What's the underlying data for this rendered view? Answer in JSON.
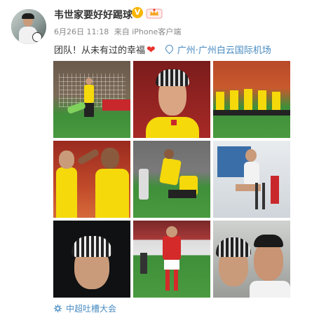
{
  "post": {
    "username": "韦世家要好好踢球",
    "verified_badge": "V",
    "date": "6月26日 11:18",
    "source": "来自 iPhone客户端",
    "text": "团队！从未有过的幸福",
    "emoji": "❤",
    "location": "广州·广州白云国际机场",
    "topic": "中超吐槽大会"
  },
  "photos": [
    {
      "label": "goal-scene"
    },
    {
      "label": "player-portrait"
    },
    {
      "label": "team-lineup"
    },
    {
      "label": "high-five"
    },
    {
      "label": "celebration-tackle"
    },
    {
      "label": "seated-player"
    },
    {
      "label": "selfie-close"
    },
    {
      "label": "player-in-red"
    },
    {
      "label": "selfie-duo"
    }
  ],
  "colors": {
    "accent_link": "#4a8bc2",
    "heart": "#e8322c",
    "badge": "#f7b500",
    "kit_yellow": "#f5d90a",
    "pitch_green": "#3f8f3a"
  }
}
